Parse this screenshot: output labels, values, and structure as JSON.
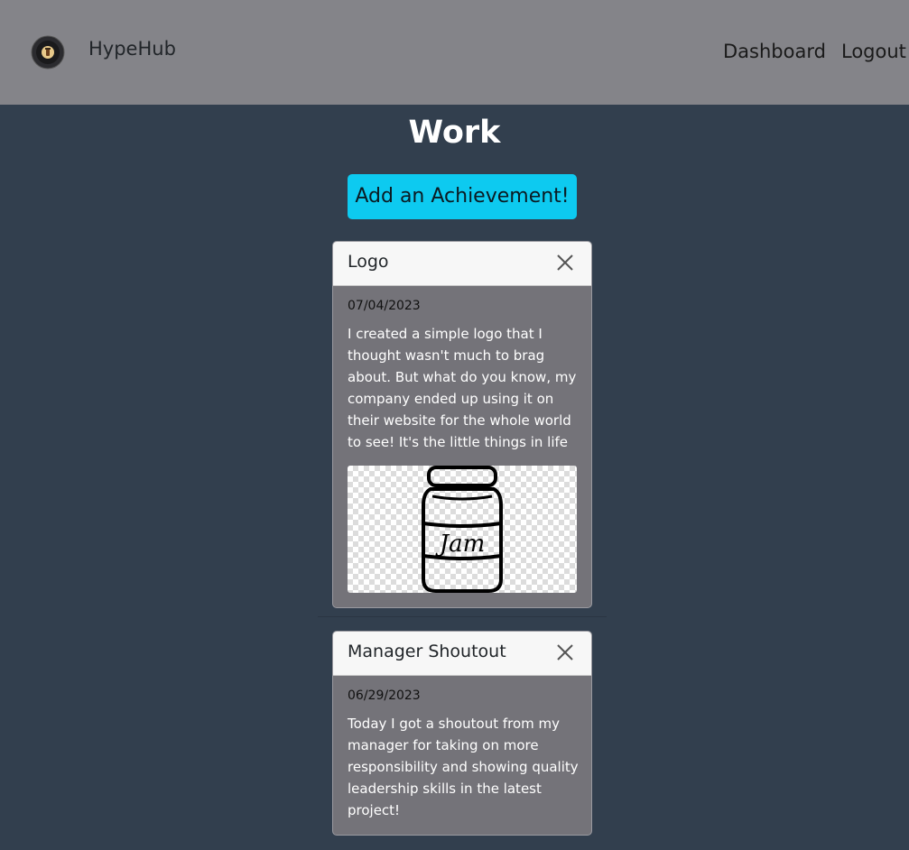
{
  "navbar": {
    "brand": "HypeHub",
    "links": [
      {
        "label": "Dashboard"
      },
      {
        "label": "Logout"
      }
    ],
    "logo_icon": "jar-logo-icon"
  },
  "page": {
    "title": "Work",
    "add_button_label": "Add an Achievement!"
  },
  "achievements": [
    {
      "title": "Logo",
      "date": "07/04/2023",
      "text": "I created a simple logo that I thought wasn't much to brag about. But what do you know, my company ended up using it on their website for the whole world to see! It's the little things in life",
      "image": {
        "label_text": "Jam",
        "icon": "jam-jar-icon"
      }
    },
    {
      "title": "Manager Shoutout",
      "date": "06/29/2023",
      "text": "Today I got a shoutout from my manager for taking on more responsibility and showing quality leadership skills in the latest project!"
    }
  ],
  "colors": {
    "navbar_bg": "#848489",
    "page_bg": "#323f4e",
    "accent_button": "#0dcaf0",
    "card_body": "#747379",
    "card_header": "#f7f7f7"
  }
}
